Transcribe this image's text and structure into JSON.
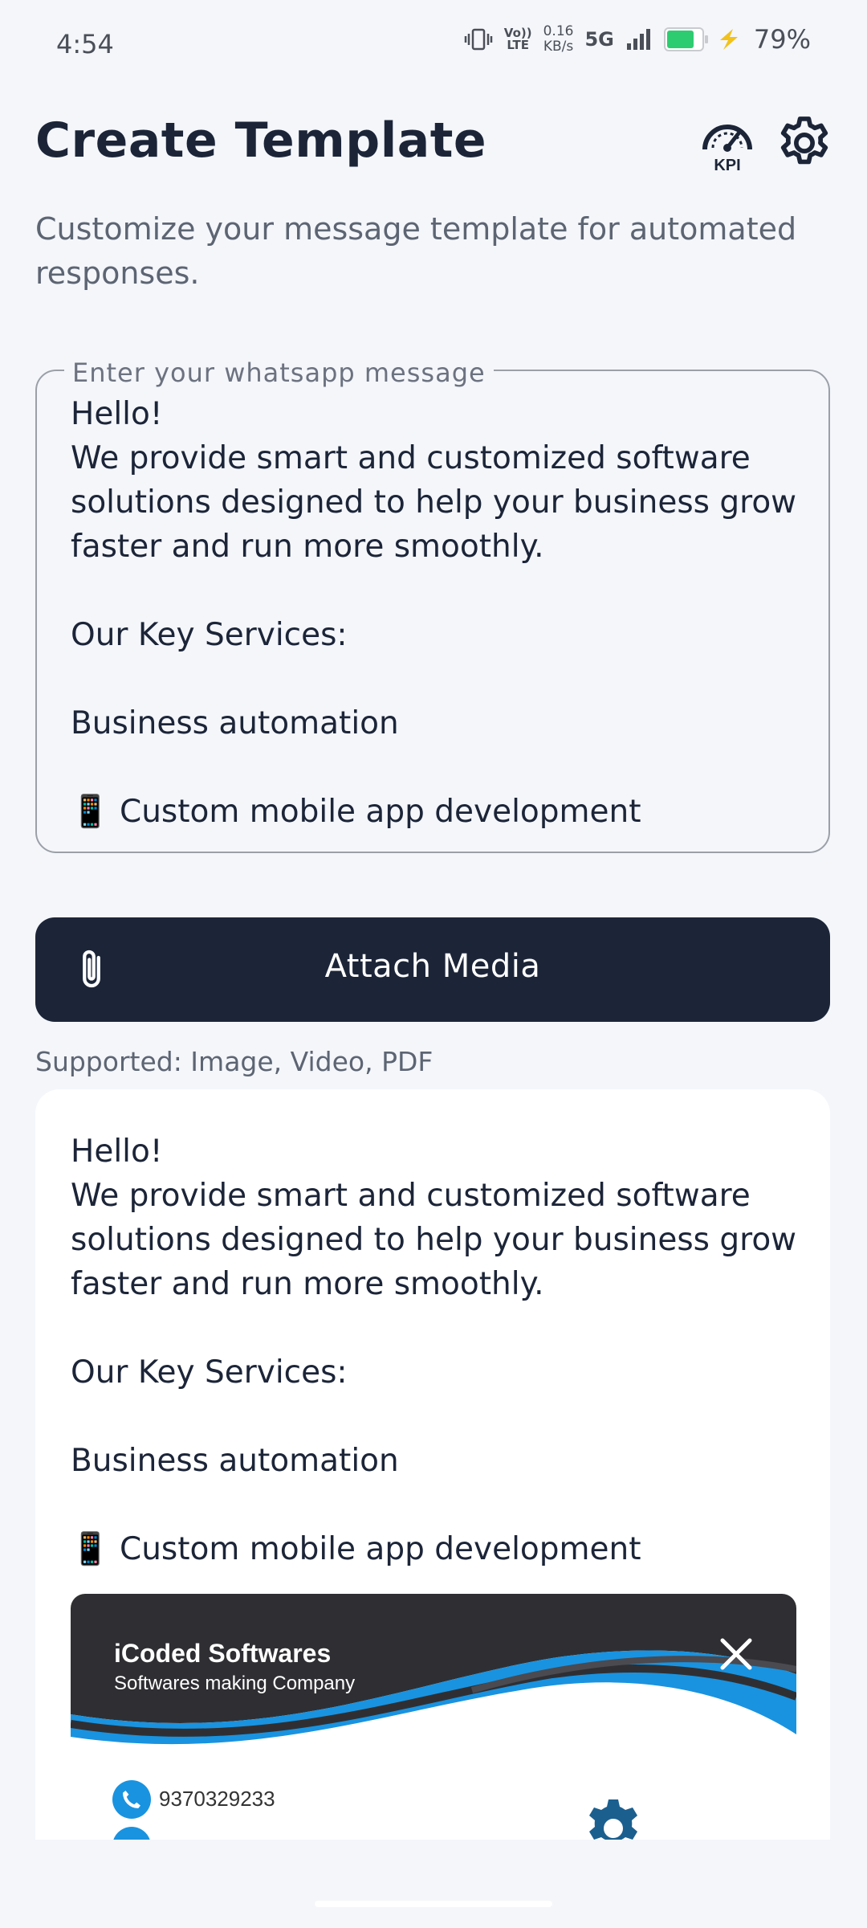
{
  "status_bar": {
    "time": "4:54",
    "volte_top": "Vo))",
    "volte_bottom": "LTE",
    "speed_value": "0.16",
    "speed_unit": "KB/s",
    "network": "5G",
    "battery_level": 0.79,
    "battery_percent": "79%"
  },
  "header": {
    "title": "Create Template",
    "kpi_icon_text": "KPI",
    "subtitle": "Customize your message template for automated responses."
  },
  "message_field": {
    "label": "Enter your whatsapp message",
    "value": "Hello!\nWe provide smart and customized software solutions designed to help your business grow faster and run more smoothly.\n\nOur Key Services:\n\nBusiness automation\n\n📱 Custom mobile app development"
  },
  "attach": {
    "label": "Attach Media",
    "supported_text": "Supported: Image, Video, PDF"
  },
  "preview": {
    "message": "Hello!\nWe provide smart and customized software solutions designed to help your business grow faster and run more smoothly.\n\nOur Key Services:\n\nBusiness automation\n\n📱 Custom mobile app development",
    "media": {
      "brand_name": "iCoded Softwares",
      "tagline": "Softwares making Company",
      "phone": "9370329233",
      "accent_color": "#1993e0",
      "dark_color": "#2f2f33"
    }
  },
  "colors": {
    "background": "#f4f6fa",
    "primary_dark": "#1c2538",
    "muted_text": "#5d6573",
    "battery_green": "#2ecc71"
  }
}
